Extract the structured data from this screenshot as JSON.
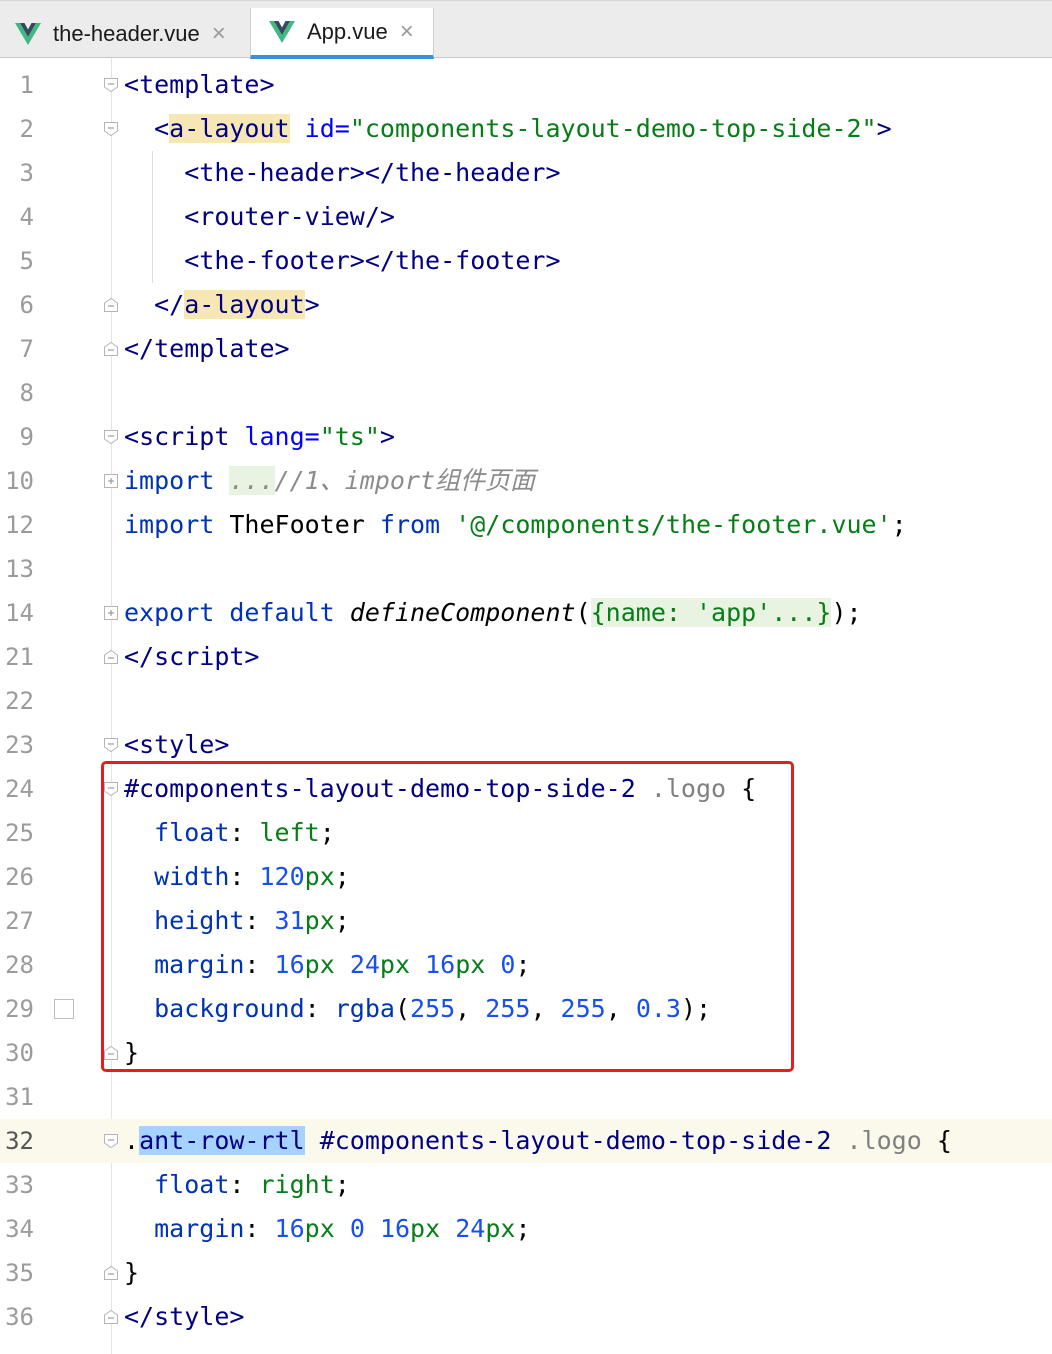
{
  "tabs": [
    {
      "name": "the-header.vue",
      "close": "×",
      "active": false,
      "icon": "vue-icon"
    },
    {
      "name": "App.vue",
      "close": "×",
      "active": true,
      "icon": "vue-icon"
    }
  ],
  "colors": {
    "vue_green": "#41b883",
    "vue_dark": "#35495e",
    "highlight_box": "#e02020",
    "active_tab_underline": "#3d8fd6"
  },
  "lines": [
    {
      "n": "1"
    },
    {
      "n": "2"
    },
    {
      "n": "3"
    },
    {
      "n": "4"
    },
    {
      "n": "5"
    },
    {
      "n": "6"
    },
    {
      "n": "7"
    },
    {
      "n": "8"
    },
    {
      "n": "9"
    },
    {
      "n": "10"
    },
    {
      "n": "12"
    },
    {
      "n": "13"
    },
    {
      "n": "14"
    },
    {
      "n": "21"
    },
    {
      "n": "22"
    },
    {
      "n": "23"
    },
    {
      "n": "24"
    },
    {
      "n": "25"
    },
    {
      "n": "26"
    },
    {
      "n": "27"
    },
    {
      "n": "28"
    },
    {
      "n": "29"
    },
    {
      "n": "30"
    },
    {
      "n": "31"
    },
    {
      "n": "32"
    },
    {
      "n": "33"
    },
    {
      "n": "34"
    },
    {
      "n": "35"
    },
    {
      "n": "36"
    }
  ],
  "code": {
    "l1": {
      "open": "<",
      "tag": "template",
      "close": ">"
    },
    "l2": {
      "open": "<",
      "tag": "a-layout",
      "attr": " id=",
      "val": "\"components-layout-demo-top-side-2\"",
      "close": ">"
    },
    "l3": {
      "a": "<",
      "t1": "the-header",
      "b": "></",
      "t2": "the-header",
      "c": ">"
    },
    "l4": {
      "a": "<",
      "t1": "router-view",
      "c": "/>"
    },
    "l5": {
      "a": "<",
      "t1": "the-footer",
      "b": "></",
      "t2": "the-footer",
      "c": ">"
    },
    "l6": {
      "a": "</",
      "tag": "a-layout",
      "c": ">"
    },
    "l7": {
      "a": "</",
      "tag": "template",
      "c": ">"
    },
    "l9": {
      "a": "<",
      "tag": "script",
      "attr": " lang=",
      "val": "\"ts\"",
      "c": ">"
    },
    "l10": {
      "kw": "import",
      "sp": " ",
      "fold": "...",
      "comment": "//1、import组件页面"
    },
    "l12": {
      "kw": "import",
      "name": " TheFooter ",
      "kw2": "from",
      "sp": " ",
      "str": "'@/components/the-footer.vue'",
      "end": ";"
    },
    "l14": {
      "kw": "export default",
      "sp": " ",
      "fn": "defineComponent",
      "p": "(",
      "fold": "{name: 'app'...}",
      "end": ");"
    },
    "l21": {
      "a": "</",
      "tag": "script",
      "c": ">"
    },
    "l23": {
      "a": "<",
      "tag": "style",
      "c": ">"
    },
    "l24": {
      "id": "#components-layout-demo-top-side-2",
      "sp": " ",
      "cls": ".logo",
      "end": " {"
    },
    "l25": {
      "prop": "float",
      "colon": ": ",
      "val": "left",
      "end": ";"
    },
    "l26": {
      "prop": "width",
      "colon": ": ",
      "num": "120",
      "unit": "px",
      "end": ";"
    },
    "l27": {
      "prop": "height",
      "colon": ": ",
      "num": "31",
      "unit": "px",
      "end": ";"
    },
    "l28": {
      "prop": "margin",
      "colon": ": ",
      "n1": "16",
      "u1": "px",
      "n2": "24",
      "u2": "px",
      "n3": "16",
      "u3": "px",
      "n4": "0",
      "end": ";"
    },
    "l29": {
      "prop": "background",
      "colon": ": ",
      "fn": "rgba",
      "p": "(",
      "a": "255",
      "b": "255",
      "c": "255",
      "d": "0.3",
      "end": ");"
    },
    "l30": {
      "brace": "}"
    },
    "l32": {
      "dot": ".",
      "cls": "ant-row-rtl",
      "sp": " ",
      "id": "#components-layout-demo-top-side-2",
      "sp2": " ",
      "cls2": ".logo",
      "end": " {"
    },
    "l33": {
      "prop": "float",
      "colon": ": ",
      "val": "right",
      "end": ";"
    },
    "l34": {
      "prop": "margin",
      "colon": ": ",
      "n1": "16",
      "u1": "px",
      "n2": "0",
      "n3": "16",
      "u3": "px",
      "n4": "24",
      "u4": "px",
      "end": ";"
    },
    "l35": {
      "brace": "}"
    },
    "l36": {
      "a": "</",
      "tag": "style",
      "c": ">"
    }
  }
}
